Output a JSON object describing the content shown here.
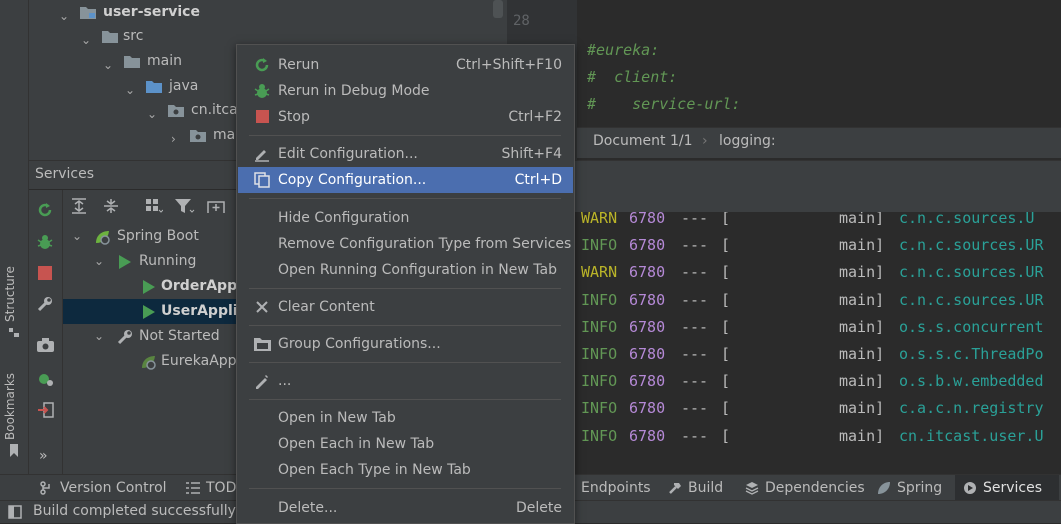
{
  "project_tree": {
    "items": [
      {
        "label": "user-service",
        "bold": true
      },
      {
        "label": "src"
      },
      {
        "label": "main"
      },
      {
        "label": "java"
      },
      {
        "label": "cn.itca"
      },
      {
        "label": "ma"
      }
    ]
  },
  "editor": {
    "line_numbers": [
      "28"
    ],
    "code_lines": [
      "#eureka:",
      "#  client:",
      "#    service-url:"
    ],
    "comment_color": "#629755"
  },
  "breadcrumb": {
    "items": [
      "Document 1/1",
      "logging:"
    ]
  },
  "left_strip": {
    "structure": "Structure",
    "bookmarks": "Bookmarks"
  },
  "services": {
    "title": "Services",
    "tree": [
      {
        "label": "Spring Boot"
      },
      {
        "label": "Running"
      },
      {
        "label": "OrderAppli"
      },
      {
        "label": "UserApplic",
        "selected": true
      },
      {
        "label": "Not Started"
      },
      {
        "label": "EurekaApp"
      }
    ],
    "more": "»"
  },
  "console": {
    "lines": [
      {
        "level": "WARN",
        "pid": "6780",
        "sep": "---",
        "open": "[",
        "thread": "main]",
        "logger": "c.n.c.sources.U"
      },
      {
        "level": "INFO",
        "pid": "6780",
        "sep": "---",
        "open": "[",
        "thread": "main]",
        "logger": "c.n.c.sources.UR"
      },
      {
        "level": "WARN",
        "pid": "6780",
        "sep": "---",
        "open": "[",
        "thread": "main]",
        "logger": "c.n.c.sources.UR"
      },
      {
        "level": "INFO",
        "pid": "6780",
        "sep": "---",
        "open": "[",
        "thread": "main]",
        "logger": "c.n.c.sources.UR"
      },
      {
        "level": "INFO",
        "pid": "6780",
        "sep": "---",
        "open": "[",
        "thread": "main]",
        "logger": "o.s.s.concurrent"
      },
      {
        "level": "INFO",
        "pid": "6780",
        "sep": "---",
        "open": "[",
        "thread": "main]",
        "logger": "o.s.s.c.ThreadPo"
      },
      {
        "level": "INFO",
        "pid": "6780",
        "sep": "---",
        "open": "[",
        "thread": "main]",
        "logger": "o.s.b.w.embedded"
      },
      {
        "level": "INFO",
        "pid": "6780",
        "sep": "---",
        "open": "[",
        "thread": "main]",
        "logger": "c.a.c.n.registry"
      },
      {
        "level": "INFO",
        "pid": "6780",
        "sep": "---",
        "open": "[",
        "thread": "main]",
        "logger": "cn.itcast.user.U"
      }
    ],
    "colors": {
      "info": "#629755",
      "warn": "#bbb529",
      "pid": "#b589d6",
      "logger": "#2aa198",
      "text": "#bbbbbb"
    }
  },
  "context_menu": {
    "items": [
      {
        "label": "Rerun",
        "shortcut": "Ctrl+Shift+F10",
        "icon": "rerun-icon"
      },
      {
        "label": "Rerun in Debug Mode",
        "shortcut": "",
        "icon": "debug-icon"
      },
      {
        "label": "Stop",
        "shortcut": "Ctrl+F2",
        "icon": "stop-icon"
      },
      {
        "label": "Edit Configuration...",
        "shortcut": "Shift+F4",
        "icon": "edit-icon"
      },
      {
        "label": "Copy Configuration...",
        "shortcut": "Ctrl+D",
        "icon": "copy-icon",
        "selected": true
      },
      {
        "label": "Hide Configuration",
        "shortcut": ""
      },
      {
        "label": "Remove Configuration Type from Services",
        "shortcut": ""
      },
      {
        "label": "Open Running Configuration in New Tab",
        "shortcut": ""
      },
      {
        "label": "Clear Content",
        "shortcut": "",
        "icon": "close-icon"
      },
      {
        "label": "Group Configurations...",
        "shortcut": "",
        "icon": "folder-icon"
      },
      {
        "label": "...",
        "shortcut": "",
        "icon": "pencil-icon"
      },
      {
        "label": "Open in New Tab",
        "shortcut": ""
      },
      {
        "label": "Open Each in New Tab",
        "shortcut": ""
      },
      {
        "label": "Open Each Type in New Tab",
        "shortcut": ""
      },
      {
        "label": "Delete...",
        "shortcut": "Delete"
      }
    ]
  },
  "bottom_tabs": [
    {
      "label": "Version Control",
      "icon": "branch-icon"
    },
    {
      "label": "TODO",
      "icon": "list-icon"
    },
    {
      "label": "Endpoints",
      "icon": "endpoints-icon"
    },
    {
      "label": "Build",
      "icon": "hammer-icon"
    },
    {
      "label": "Dependencies",
      "icon": "layers-icon"
    },
    {
      "label": "Spring",
      "icon": "leaf-icon"
    },
    {
      "label": "Services",
      "icon": "services-icon",
      "active": true
    }
  ],
  "status_bar": {
    "text": "Build completed successfully in"
  },
  "colors": {
    "accent": "#4b6eaf",
    "run_green": "#499c54",
    "stop_red": "#c75450",
    "folder_blue": "#5c92c9"
  }
}
